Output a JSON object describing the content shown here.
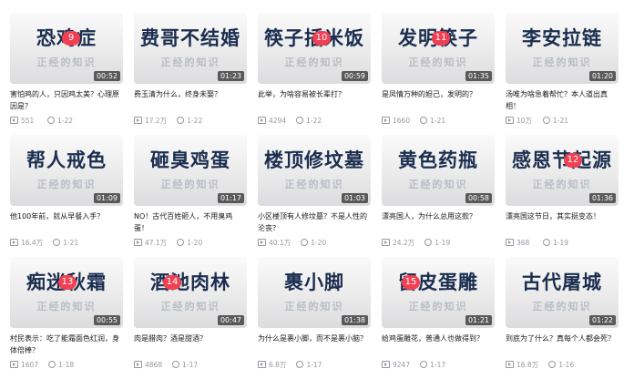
{
  "thumb_subtitle": "正经的知识",
  "cards": [
    {
      "thumb_title": "恐鸡症",
      "duration": "00:52",
      "title": "害怕鸡的人，只因鸡太美？心理原因是？",
      "views": "551",
      "episodes": "1-22",
      "badge": "9"
    },
    {
      "thumb_title": "费哥不结婚",
      "duration": "01:23",
      "title": "费玉清为什么，终身未娶？",
      "views": "17.2万",
      "episodes": "1-22",
      "badge": ""
    },
    {
      "thumb_title": "筷子插米饭",
      "duration": "00:59",
      "title": "此举，为啥容易被长辈打？",
      "views": "4294",
      "episodes": "1-22",
      "badge": "10"
    },
    {
      "thumb_title": "发明筷子",
      "duration": "01:35",
      "title": "是凤情万种的妲己，发明的？",
      "views": "1660",
      "episodes": "1-21",
      "badge": "11"
    },
    {
      "thumb_title": "李安拉链",
      "duration": "01:20",
      "title": "汤唯为啥急着帮忙？本人道出真相！",
      "views": "10万",
      "episodes": "1-21",
      "badge": ""
    },
    {
      "thumb_title": "帮人戒色",
      "duration": "01:09",
      "title": "他100年前，就从早餐入手？",
      "views": "16.4万",
      "episodes": "1-21",
      "badge": ""
    },
    {
      "thumb_title": "砸臭鸡蛋",
      "duration": "01:17",
      "title": "NO！古代百姓砸人，不用臭鸡蛋！",
      "views": "47.1万",
      "episodes": "1-20",
      "badge": ""
    },
    {
      "thumb_title": "楼顶修坟墓",
      "duration": "01:03",
      "title": "小区楼顶有人修坟墓？不是人性的沦丧？",
      "views": "40.1万",
      "episodes": "1-20",
      "badge": ""
    },
    {
      "thumb_title": "黄色药瓶",
      "duration": "00:58",
      "title": "漂亮国人，为什么总用这款？",
      "views": "24.2万",
      "episodes": "1-19",
      "badge": ""
    },
    {
      "thumb_title": "感恩节起源",
      "duration": "01:36",
      "title": "漂亮国这节日，其实挺变态！",
      "views": "368",
      "episodes": "1-19",
      "badge": "12"
    },
    {
      "thumb_title": "痴迷秋霜",
      "duration": "00:55",
      "title": "村民表示：吃了能霜面色红润，身体倍棒？",
      "views": "1607",
      "episodes": "1-18",
      "badge": "13"
    },
    {
      "thumb_title": "酒池肉林",
      "duration": "00:47",
      "title": "肉是腊肉？酒是甜酒？",
      "views": "4868",
      "episodes": "1-17",
      "badge": "14"
    },
    {
      "thumb_title": "裹小脚",
      "duration": "01:38",
      "title": "为什么是裹小脚，而不是裹小脑？",
      "views": "6.8万",
      "episodes": "1-17",
      "badge": ""
    },
    {
      "thumb_title": "留皮蛋雕",
      "duration": "01:21",
      "title": "给鸡蛋雕花，普通人也做得到？",
      "views": "9247",
      "episodes": "1-17",
      "badge": "15"
    },
    {
      "thumb_title": "古代屠城",
      "duration": "01:22",
      "title": "到底为了什么？真每个人都会死？",
      "views": "16.8万",
      "episodes": "1-16",
      "badge": ""
    }
  ]
}
